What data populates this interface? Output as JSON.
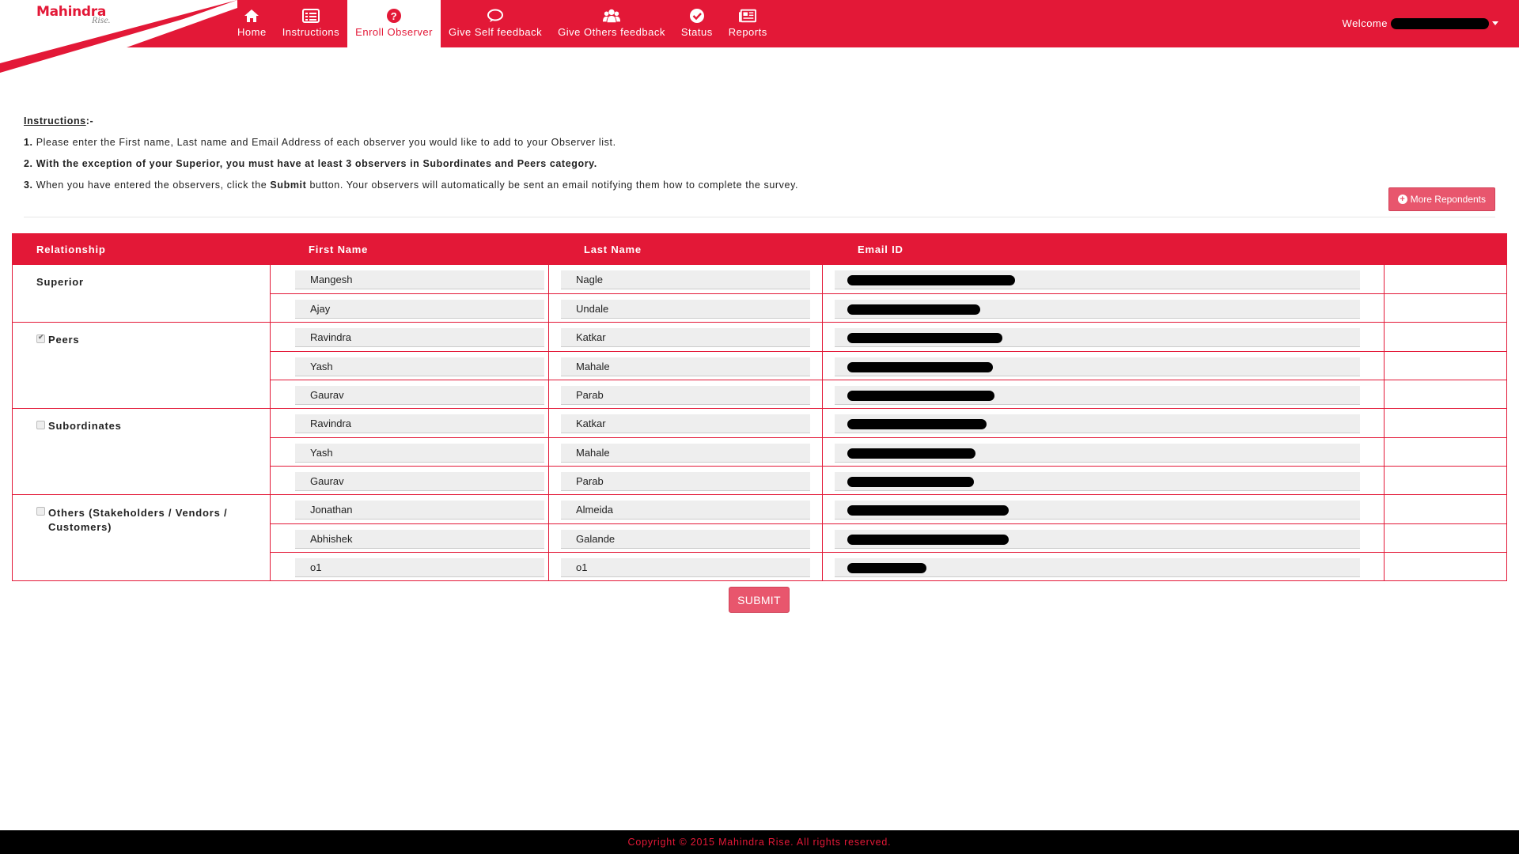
{
  "header": {
    "logo": "Mahindra",
    "logo_sub": "Rise.",
    "welcome": "Welcome",
    "nav": [
      {
        "label": "Home",
        "icon": "home-icon"
      },
      {
        "label": "Instructions",
        "icon": "list-icon"
      },
      {
        "label": "Enroll Observer",
        "icon": "question-icon",
        "active": true
      },
      {
        "label": "Give Self feedback",
        "icon": "chat-icon"
      },
      {
        "label": "Give Others feedback",
        "icon": "users-icon"
      },
      {
        "label": "Status",
        "icon": "check-circle-icon"
      },
      {
        "label": "Reports",
        "icon": "newspaper-icon"
      }
    ]
  },
  "instructions": {
    "title": "Instructions",
    "title_suffix": ":-",
    "items": [
      {
        "num": "1.",
        "text": "Please enter the First name, Last name and Email Address of each observer you would like to add to your Observer list."
      },
      {
        "num": "2.",
        "text": "With the exception of your Superior, you must have at least 3 observers in Subordinates and Peers category."
      },
      {
        "num": "3.",
        "text_pre": "When you have entered the observers, click the ",
        "text_bold": "Submit",
        "text_post": " button. Your observers will automatically be sent an email notifying them how to complete the survey."
      }
    ],
    "more_button": "More Repondents"
  },
  "table": {
    "headers": {
      "relationship": "Relationship",
      "first": "First Name",
      "last": "Last Name",
      "email": "Email ID"
    },
    "groups": [
      {
        "label": "Superior",
        "checkbox": "none",
        "rows": [
          {
            "first": "Mangesh",
            "last": "Nagle"
          },
          {
            "first": "Ajay",
            "last": "Undale"
          }
        ]
      },
      {
        "label": "Peers",
        "checkbox": "checked",
        "rows": [
          {
            "first": "Ravindra",
            "last": "Katkar"
          },
          {
            "first": "Yash",
            "last": "Mahale"
          },
          {
            "first": "Gaurav",
            "last": "Parab"
          }
        ]
      },
      {
        "label": "Subordinates",
        "checkbox": "unchecked",
        "rows": [
          {
            "first": "Ravindra",
            "last": "Katkar"
          },
          {
            "first": "Yash",
            "last": "Mahale"
          },
          {
            "first": "Gaurav",
            "last": "Parab"
          }
        ]
      },
      {
        "label": "Others (Stakeholders / Vendors / Customers)",
        "checkbox": "unchecked",
        "rows": [
          {
            "first": "Jonathan",
            "last": "Almeida"
          },
          {
            "first": "Abhishek",
            "last": "Galande"
          },
          {
            "first": "o1",
            "last": "o1"
          }
        ]
      }
    ]
  },
  "submit_label": "SUBMIT",
  "footer": "Copyright © 2015 Mahindra Rise. All rights reserved.",
  "colors": {
    "brand": "#e31837",
    "button": "#e8566d"
  }
}
